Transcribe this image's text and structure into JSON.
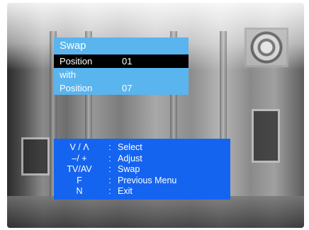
{
  "menu": {
    "title": "Swap",
    "rows": [
      {
        "label": "Position",
        "value": "01"
      },
      {
        "label": "with",
        "value": ""
      },
      {
        "label": "Position",
        "value": "07"
      }
    ]
  },
  "help": {
    "items": [
      {
        "key": "V / Λ",
        "sep": ":",
        "desc": "Select"
      },
      {
        "key": "–/ +",
        "sep": ":",
        "desc": "Adjust"
      },
      {
        "key": "TV/AV",
        "sep": ":",
        "desc": "Swap"
      },
      {
        "key": "F",
        "sep": ":",
        "desc": "Previous Menu"
      },
      {
        "key": "N",
        "sep": ":",
        "desc": "Exit"
      }
    ]
  },
  "colors": {
    "menu_bg": "#5ab4ee",
    "selected_bg": "#000000",
    "help_bg": "#1564f0",
    "text": "#ffffff"
  }
}
